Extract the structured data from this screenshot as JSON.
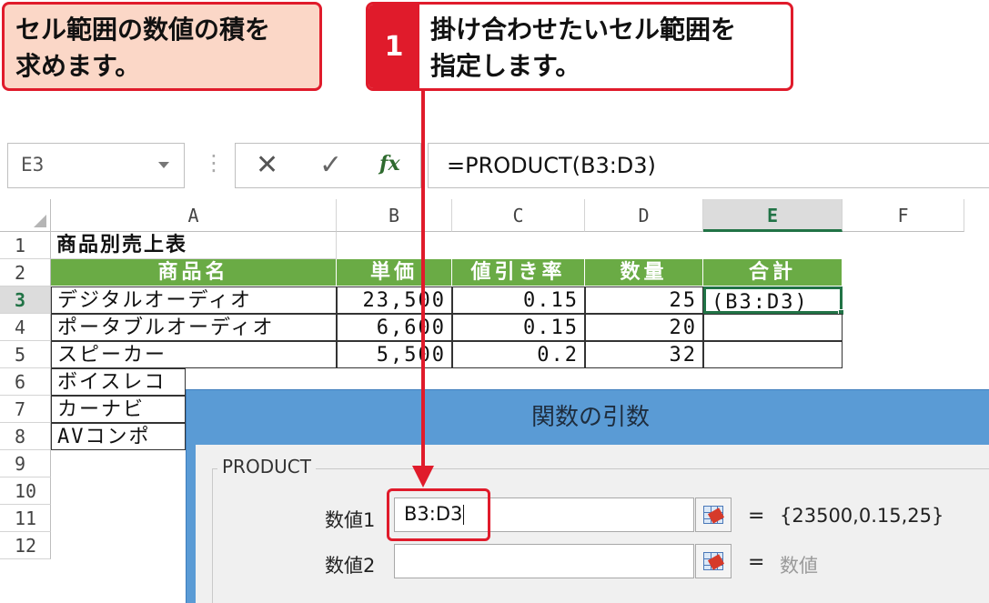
{
  "callouts": {
    "purpose_line1": "セル範囲の数値の積を",
    "purpose_line2": "求めます。",
    "step_number": "1",
    "step_line1": "掛け合わせたいセル範囲を",
    "step_line2": "指定します。"
  },
  "formula_bar": {
    "name_box": "E3",
    "cancel_icon": "✕",
    "enter_icon": "✓",
    "fx_label": "fx",
    "formula": "=PRODUCT(B3:D3)"
  },
  "columns": [
    "A",
    "B",
    "C",
    "D",
    "E",
    "F"
  ],
  "rows": [
    "1",
    "2",
    "3",
    "4",
    "5",
    "6",
    "7",
    "8",
    "9",
    "10",
    "11",
    "12"
  ],
  "sheet": {
    "title": "商品別売上表",
    "headers": [
      "商品名",
      "単価",
      "値引き率",
      "数量",
      "合計"
    ],
    "data": [
      {
        "name": "デジタルオーディオ",
        "price": "23,500",
        "discount": "0.15",
        "qty": "25",
        "total": "(B3:D3)"
      },
      {
        "name": "ポータブルオーディオ",
        "price": "6,600",
        "discount": "0.15",
        "qty": "20",
        "total": ""
      },
      {
        "name": "スピーカー",
        "price": "5,500",
        "discount": "0.2",
        "qty": "32",
        "total": ""
      },
      {
        "name": "ボイスレコ",
        "price": "",
        "discount": "",
        "qty": "",
        "total": ""
      },
      {
        "name": "カーナビ",
        "price": "",
        "discount": "",
        "qty": "",
        "total": ""
      },
      {
        "name": "AVコンポ",
        "price": "",
        "discount": "",
        "qty": "",
        "total": ""
      }
    ]
  },
  "dialog": {
    "title": "関数の引数",
    "function_name": "PRODUCT",
    "arg1_label": "数値1",
    "arg1_value": "B3:D3",
    "arg1_result": "{23500,0.15,25}",
    "arg2_label": "数値2",
    "arg2_value": "",
    "arg2_result": "数値",
    "equals": "="
  },
  "colors": {
    "accent_red": "#e01b2b",
    "header_green": "#6aab45",
    "excel_green": "#217346",
    "dialog_blue": "#5a9bd5"
  }
}
